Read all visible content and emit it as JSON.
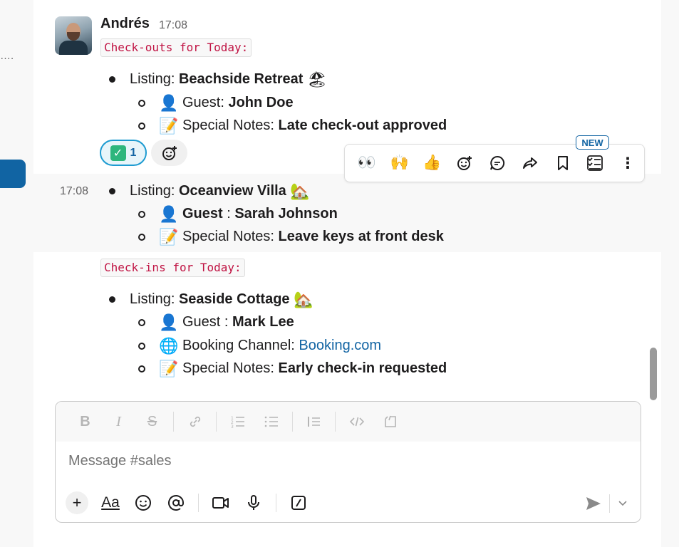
{
  "sidebar": {
    "ellipsis": "…."
  },
  "message": {
    "author": "Andrés",
    "time": "17:08",
    "checkouts_header": "Check-outs for Today:",
    "checkins_header": "Check-ins for Today:",
    "listing_prefix": "Listing: ",
    "guest_prefix": "Guest: ",
    "guest_prefix_spaced": "Guest",
    "guest_colon": " : ",
    "notes_prefix": "Special Notes: ",
    "channel_prefix": "Booking Channel: ",
    "checkouts": [
      {
        "listing": "Beachside Retreat",
        "listing_emoji": "🏖",
        "guest": "John Doe",
        "notes": "Late check-out approved"
      },
      {
        "listing": "Oceanview Villa",
        "listing_emoji": "🏡",
        "guest": "Sarah Johnson",
        "notes": "Leave keys at front desk"
      }
    ],
    "checkins": [
      {
        "listing": "Seaside Cottage",
        "listing_emoji": "🏡",
        "guest": "Mark Lee",
        "channel": "Booking.com",
        "notes": "Early check-in requested"
      }
    ],
    "second_time": "17:08",
    "guest_emoji": "👤",
    "notes_emoji": "📝",
    "channel_emoji": "🌐"
  },
  "reactions": [
    {
      "emoji": "✓",
      "count": "1"
    }
  ],
  "add_reaction_icon": "add-reaction-icon",
  "toolbar": {
    "new_badge": "NEW",
    "items": [
      "👀",
      "🙌",
      "👍",
      "☺+",
      "💬",
      "↪",
      "🔖",
      "☑",
      "⋮"
    ]
  },
  "composer": {
    "placeholder": "Message #sales",
    "format_bar": [
      "B",
      "I",
      "S",
      "🔗",
      "≔",
      "☰",
      "▐≡",
      "</>",
      "⎘"
    ],
    "aa": "Aa"
  },
  "colors": {
    "accent": "#1264a3",
    "code": "#c01343",
    "reaction_border": "#1d9bd1"
  }
}
